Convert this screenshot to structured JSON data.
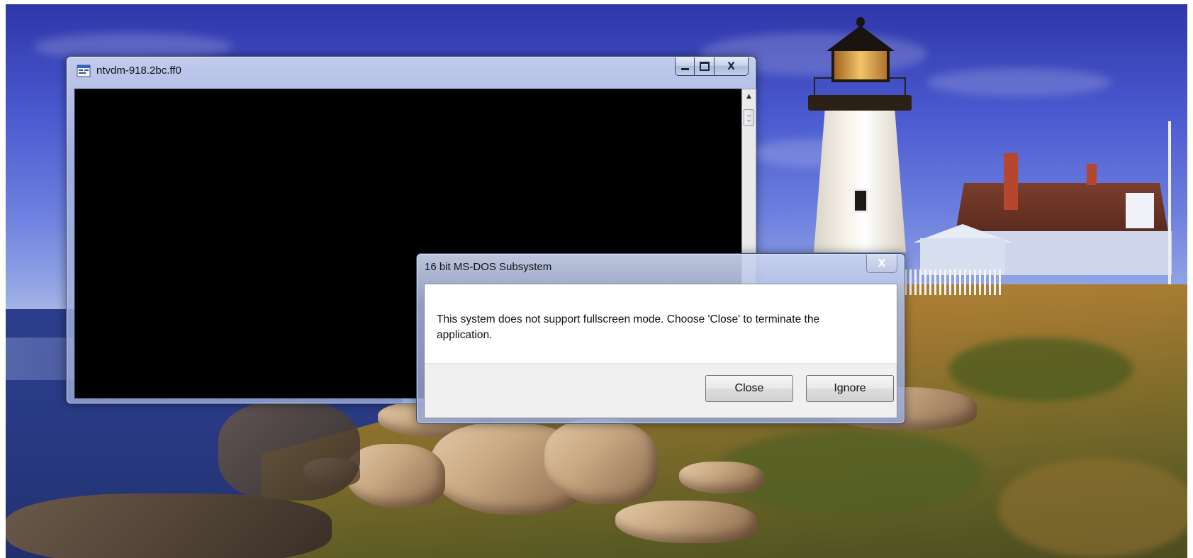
{
  "console_window": {
    "title": "ntvdm-918.2bc.ff0",
    "icon": "dos-app-icon",
    "buttons": {
      "minimize": "minimize-icon",
      "maximize": "maximize-icon",
      "close": "X"
    },
    "scrollbar": {
      "up": "▲"
    }
  },
  "dialog": {
    "title": "16 bit MS-DOS Subsystem",
    "close_glyph": "X",
    "message": "This system does not support fullscreen mode. Choose 'Close' to terminate the application.",
    "buttons": {
      "close_label": "Close",
      "ignore_label": "Ignore"
    }
  },
  "desktop": {
    "wallpaper": "lighthouse-coast"
  }
}
